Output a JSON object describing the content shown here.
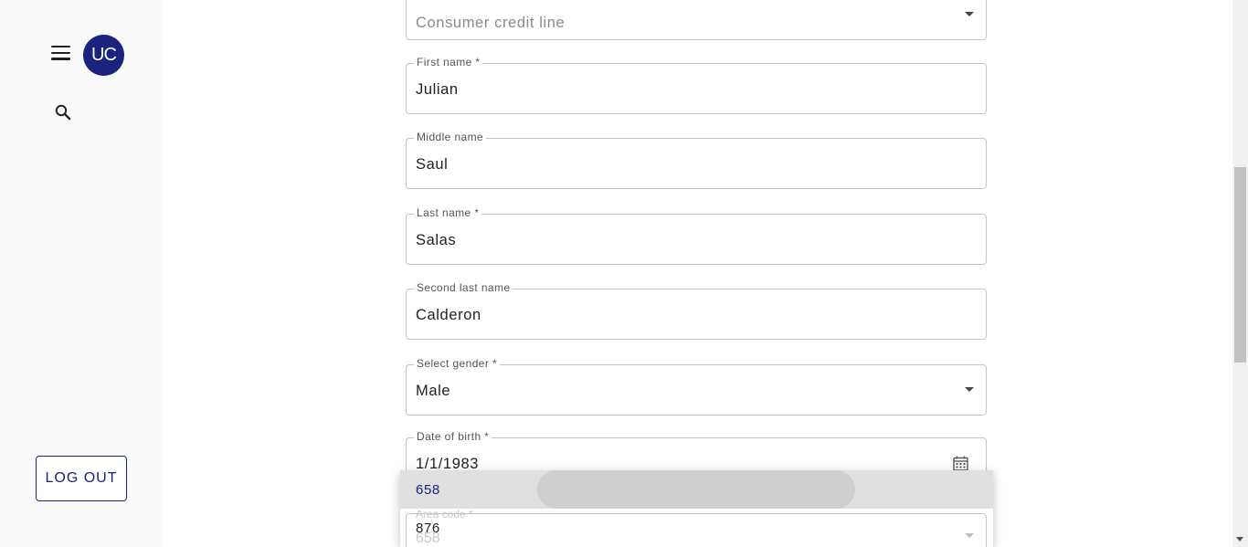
{
  "sidebar": {
    "avatar_initials": "UC",
    "logout_label": "LOG OUT"
  },
  "form": {
    "product": {
      "value": "Consumer credit line"
    },
    "first_name": {
      "label": "First name *",
      "value": "Julian"
    },
    "middle_name": {
      "label": "Middle name",
      "value": "Saul"
    },
    "last_name": {
      "label": "Last name *",
      "value": "Salas"
    },
    "second_last_name": {
      "label": "Second last name",
      "value": "Calderon"
    },
    "gender": {
      "label": "Select gender *",
      "value": "Male"
    },
    "date_of_birth": {
      "label": "Date of birth *",
      "value": "1/1/1983"
    },
    "area_code": {
      "label": "Area code *",
      "value": "658"
    }
  },
  "area_code_dropdown": {
    "options": [
      "658",
      "876"
    ],
    "selected": "658"
  },
  "colors": {
    "brand": "#1a237e",
    "selected_option_bg": "#e0e0e0"
  }
}
